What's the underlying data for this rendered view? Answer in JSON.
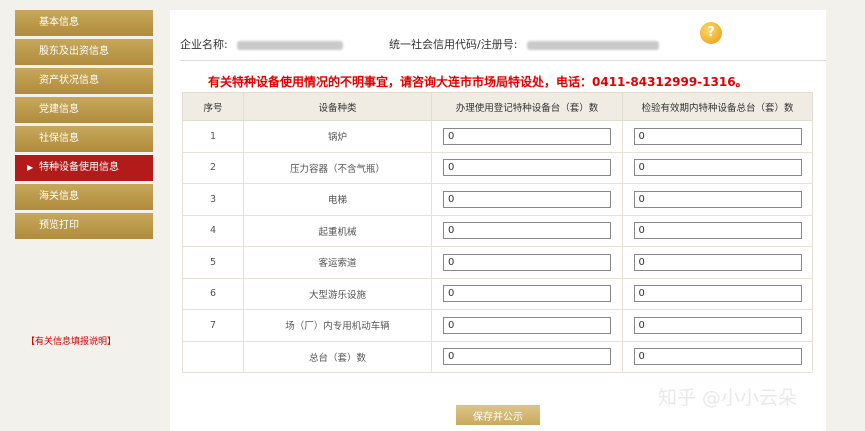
{
  "sidebar": {
    "items": [
      {
        "label": "基本信息"
      },
      {
        "label": "股东及出资信息"
      },
      {
        "label": "资产状况信息"
      },
      {
        "label": "党建信息"
      },
      {
        "label": "社保信息"
      },
      {
        "label": "特种设备使用信息",
        "active": true
      },
      {
        "label": "海关信息"
      },
      {
        "label": "预览打印"
      }
    ],
    "help_link": "【有关信息填报说明】"
  },
  "header": {
    "company_label": "企业名称:",
    "credit_label": "统一社会信用代码/注册号:",
    "help_icon": "?"
  },
  "notice": "有关特种设备使用情况的不明事宜，请咨询大连市市场局特设处，电话：0411-84312999-1316。",
  "table": {
    "headers": [
      "序号",
      "设备种类",
      "办理使用登记特种设备台（套）数",
      "检验有效期内特种设备总台（套）数"
    ],
    "rows": [
      {
        "no": "1",
        "type": "锅炉",
        "registered": "0",
        "inspected": "0"
      },
      {
        "no": "2",
        "type": "压力容器（不含气瓶）",
        "registered": "0",
        "inspected": "0"
      },
      {
        "no": "3",
        "type": "电梯",
        "registered": "0",
        "inspected": "0"
      },
      {
        "no": "4",
        "type": "起重机械",
        "registered": "0",
        "inspected": "0"
      },
      {
        "no": "5",
        "type": "客运索道",
        "registered": "0",
        "inspected": "0"
      },
      {
        "no": "6",
        "type": "大型游乐设施",
        "registered": "0",
        "inspected": "0"
      },
      {
        "no": "7",
        "type": "场（厂）内专用机动车辆",
        "registered": "0",
        "inspected": "0"
      },
      {
        "no": "",
        "type": "总台（套）数",
        "registered": "0",
        "inspected": "0"
      }
    ]
  },
  "save_button": "保存并公示",
  "watermark": "知乎 @小小云朵",
  "colors": {
    "sidebar_gold": "#b08b3d",
    "sidebar_active": "#b31b1b",
    "notice_red": "#e00000"
  }
}
